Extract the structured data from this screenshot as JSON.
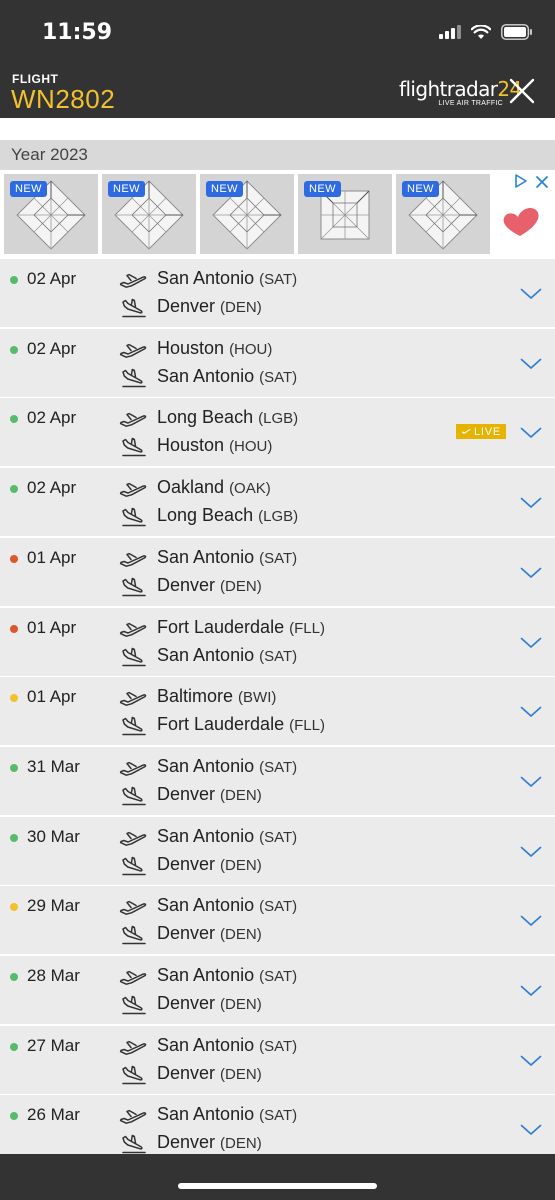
{
  "status_bar": {
    "time": "11:59"
  },
  "header": {
    "label": "FLIGHT",
    "flight_number": "WN2802",
    "logo_text": "flightradar",
    "logo_number": "24",
    "logo_tagline": "LIVE AIR TRAFFIC",
    "accent_color": "#f2c12e"
  },
  "year_header": "Year 2023",
  "ad": {
    "badge": "NEW",
    "tiles": 5,
    "icons": [
      "adchoices-icon",
      "close-icon",
      "heart-icon"
    ]
  },
  "live_badge": "LIVE",
  "status_colors": {
    "green": "#57bb6b",
    "red": "#e0562a",
    "yellow": "#f2c12e"
  },
  "flights": [
    {
      "date": "02 Apr",
      "status": "green",
      "from_city": "San Antonio",
      "from_code": "(SAT)",
      "to_city": "Denver",
      "to_code": "(DEN)",
      "live": false
    },
    {
      "date": "02 Apr",
      "status": "green",
      "from_city": "Houston",
      "from_code": "(HOU)",
      "to_city": "San Antonio",
      "to_code": "(SAT)",
      "live": false
    },
    {
      "date": "02 Apr",
      "status": "green",
      "from_city": "Long Beach",
      "from_code": "(LGB)",
      "to_city": "Houston",
      "to_code": "(HOU)",
      "live": true
    },
    {
      "date": "02 Apr",
      "status": "green",
      "from_city": "Oakland",
      "from_code": "(OAK)",
      "to_city": "Long Beach",
      "to_code": "(LGB)",
      "live": false
    },
    {
      "date": "01 Apr",
      "status": "red",
      "from_city": "San Antonio",
      "from_code": "(SAT)",
      "to_city": "Denver",
      "to_code": "(DEN)",
      "live": false
    },
    {
      "date": "01 Apr",
      "status": "red",
      "from_city": "Fort Lauderdale",
      "from_code": "(FLL)",
      "to_city": "San Antonio",
      "to_code": "(SAT)",
      "live": false
    },
    {
      "date": "01 Apr",
      "status": "yellow",
      "from_city": "Baltimore",
      "from_code": "(BWI)",
      "to_city": "Fort Lauderdale",
      "to_code": "(FLL)",
      "live": false
    },
    {
      "date": "31 Mar",
      "status": "green",
      "from_city": "San Antonio",
      "from_code": "(SAT)",
      "to_city": "Denver",
      "to_code": "(DEN)",
      "live": false
    },
    {
      "date": "30 Mar",
      "status": "green",
      "from_city": "San Antonio",
      "from_code": "(SAT)",
      "to_city": "Denver",
      "to_code": "(DEN)",
      "live": false
    },
    {
      "date": "29 Mar",
      "status": "yellow",
      "from_city": "San Antonio",
      "from_code": "(SAT)",
      "to_city": "Denver",
      "to_code": "(DEN)",
      "live": false
    },
    {
      "date": "28 Mar",
      "status": "green",
      "from_city": "San Antonio",
      "from_code": "(SAT)",
      "to_city": "Denver",
      "to_code": "(DEN)",
      "live": false
    },
    {
      "date": "27 Mar",
      "status": "green",
      "from_city": "San Antonio",
      "from_code": "(SAT)",
      "to_city": "Denver",
      "to_code": "(DEN)",
      "live": false
    },
    {
      "date": "26 Mar",
      "status": "green",
      "from_city": "San Antonio",
      "from_code": "(SAT)",
      "to_city": "Denver",
      "to_code": "(DEN)",
      "live": false
    }
  ]
}
